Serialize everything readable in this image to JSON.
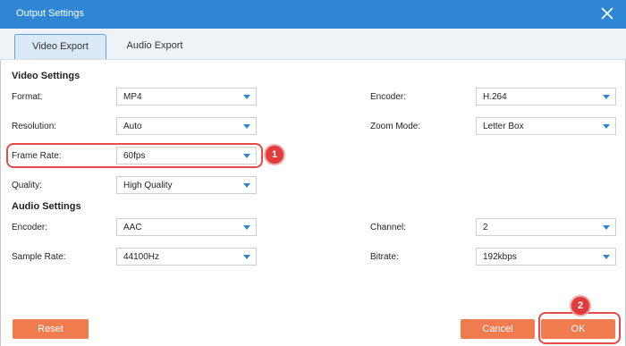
{
  "window": {
    "title": "Output Settings"
  },
  "tabs": [
    {
      "label": "Video Export",
      "active": true
    },
    {
      "label": "Audio Export",
      "active": false
    }
  ],
  "video_settings": {
    "heading": "Video Settings",
    "format": {
      "label": "Format:",
      "value": "MP4"
    },
    "encoder": {
      "label": "Encoder:",
      "value": "H.264"
    },
    "resolution": {
      "label": "Resolution:",
      "value": "Auto"
    },
    "zoom_mode": {
      "label": "Zoom Mode:",
      "value": "Letter Box"
    },
    "frame_rate": {
      "label": "Frame Rate:",
      "value": "60fps"
    },
    "quality": {
      "label": "Quality:",
      "value": "High Quality"
    }
  },
  "audio_settings": {
    "heading": "Audio Settings",
    "encoder": {
      "label": "Encoder:",
      "value": "AAC"
    },
    "channel": {
      "label": "Channel:",
      "value": "2"
    },
    "sample_rate": {
      "label": "Sample Rate:",
      "value": "44100Hz"
    },
    "bitrate": {
      "label": "Bitrate:",
      "value": "192kbps"
    }
  },
  "annotations": {
    "step1": "1",
    "step2": "2"
  },
  "buttons": {
    "reset": "Reset",
    "cancel": "Cancel",
    "ok": "OK"
  },
  "colors": {
    "titlebar": "#2f86d4",
    "accent": "#2f86d4",
    "button": "#f07b4f",
    "highlight": "#e64b4b"
  }
}
